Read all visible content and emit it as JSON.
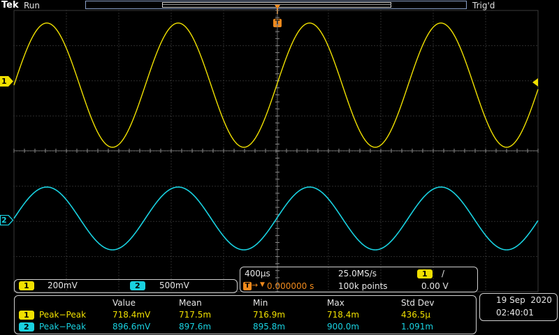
{
  "header": {
    "brand": "Tek",
    "run_state": "Run",
    "trigger_state": "Trig'd",
    "trigger_marker": "T"
  },
  "channels": {
    "ch1_marker": "1",
    "ch2_marker": "2",
    "ch1_color": "#f0e000",
    "ch2_color": "#19d1e0"
  },
  "vertical": {
    "ch1_label": "1",
    "ch1_scale": "200mV",
    "ch2_label": "2",
    "ch2_scale": "500mV"
  },
  "horizontal": {
    "timebase": "400µs",
    "sample_rate": "25.0MS/s",
    "trigger_source": "1",
    "trigger_slope": "/",
    "trigger_position_icon": "T",
    "trigger_position": "0.000000 s",
    "record_length": "100k points",
    "trigger_level": "0.00 V"
  },
  "measurements": {
    "headers": [
      "Value",
      "Mean",
      "Min",
      "Max",
      "Std Dev"
    ],
    "rows": [
      {
        "channel": "1",
        "name": "Peak−Peak",
        "value": "718.4mV",
        "mean": "717.5m",
        "min": "716.9m",
        "max": "718.4m",
        "std": "436.5µ"
      },
      {
        "channel": "2",
        "name": "Peak−Peak",
        "value": "896.6mV",
        "mean": "897.6m",
        "min": "895.8m",
        "max": "900.0m",
        "std": "1.091m"
      }
    ]
  },
  "datetime": {
    "date": "19 Sep  2020",
    "time": "02:40:01"
  }
}
